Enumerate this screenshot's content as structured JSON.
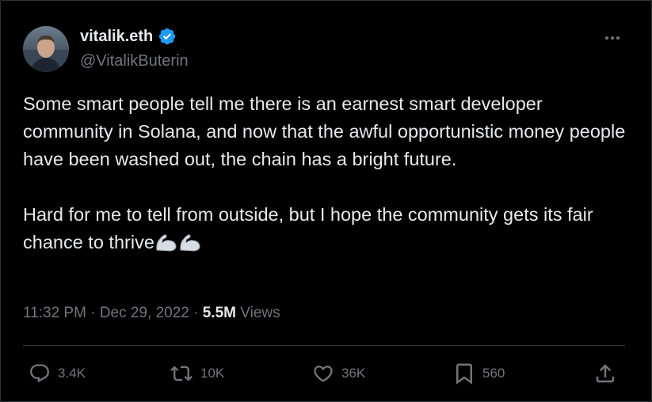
{
  "author": {
    "display_name": "vitalik.eth",
    "handle": "@VitalikButerin",
    "avatar_icon": "profile-photo",
    "verified_icon": "verified-badge-icon"
  },
  "tweet": {
    "paragraph_1": "Some smart people tell me there is an earnest smart developer community in Solana, and now that the awful opportunistic money people have been washed out, the chain has a bright future.",
    "paragraph_2": "Hard for me to tell from outside, but I hope the community gets its fair chance to thrive",
    "emojis": [
      "flexed-biceps-icon",
      "flexed-biceps-icon"
    ]
  },
  "meta": {
    "time": "11:32 PM",
    "separator": " · ",
    "date": "Dec 29, 2022",
    "views_count": "5.5M",
    "views_label": "Views"
  },
  "actions": {
    "reply_count": "3.4K",
    "repost_count": "10K",
    "like_count": "36K",
    "bookmark_count": "560"
  },
  "colors": {
    "background": "#000000",
    "text_primary": "#e7e9ea",
    "text_secondary": "#71767b",
    "verified_blue": "#1d9bf0",
    "divider": "#2f3336"
  }
}
